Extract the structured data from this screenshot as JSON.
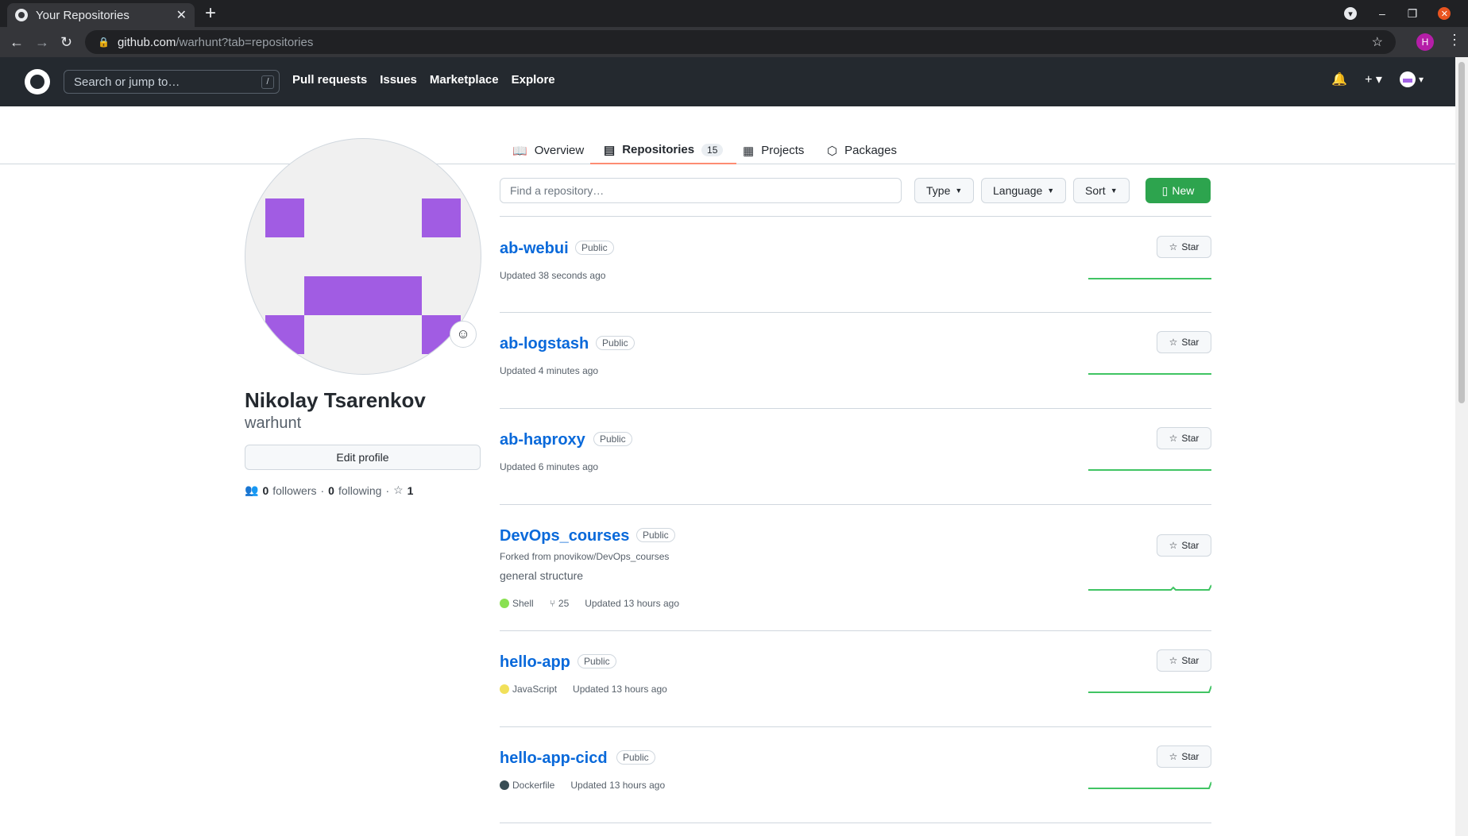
{
  "browser": {
    "tab_title": "Your Repositories",
    "url_host": "github.com",
    "url_path": "/warhunt?tab=repositories",
    "profile_initial": "H"
  },
  "header": {
    "search_placeholder": "Search or jump to…",
    "search_shortcut": "/",
    "nav": [
      "Pull requests",
      "Issues",
      "Marketplace",
      "Explore"
    ]
  },
  "profile_tabs": [
    {
      "label": "Overview"
    },
    {
      "label": "Repositories",
      "count": "15"
    },
    {
      "label": "Projects"
    },
    {
      "label": "Packages"
    }
  ],
  "profile": {
    "name": "Nikolay Tsarenkov",
    "login": "warhunt",
    "edit_label": "Edit profile",
    "followers_count": "0",
    "followers_label": "followers",
    "following_count": "0",
    "following_label": "following",
    "stars_count": "1"
  },
  "filters": {
    "find_placeholder": "Find a repository…",
    "type_label": "Type",
    "language_label": "Language",
    "sort_label": "Sort",
    "new_label": "New"
  },
  "repos": [
    {
      "name": "ab-webui",
      "visibility": "Public",
      "updated": "Updated 38 seconds ago"
    },
    {
      "name": "ab-logstash",
      "visibility": "Public",
      "updated": "Updated 4 minutes ago"
    },
    {
      "name": "ab-haproxy",
      "visibility": "Public",
      "updated": "Updated 6 minutes ago"
    },
    {
      "name": "DevOps_courses",
      "visibility": "Public",
      "fork": "Forked from pnovikow/DevOps_courses",
      "description": "general structure",
      "language": "Shell",
      "language_color": "#89e051",
      "forks": "25",
      "updated": "Updated 13 hours ago"
    },
    {
      "name": "hello-app",
      "visibility": "Public",
      "language": "JavaScript",
      "language_color": "#f1e05a",
      "updated": "Updated 13 hours ago"
    },
    {
      "name": "hello-app-cicd",
      "visibility": "Public",
      "language": "Dockerfile",
      "language_color": "#384d54",
      "updated": "Updated 13 hours ago"
    }
  ],
  "star_label": "Star",
  "colors": {
    "accent_green": "#2da44e",
    "link_blue": "#0969da",
    "avatar_purple": "#a15ce3",
    "tab_underline": "#fd8c73"
  }
}
